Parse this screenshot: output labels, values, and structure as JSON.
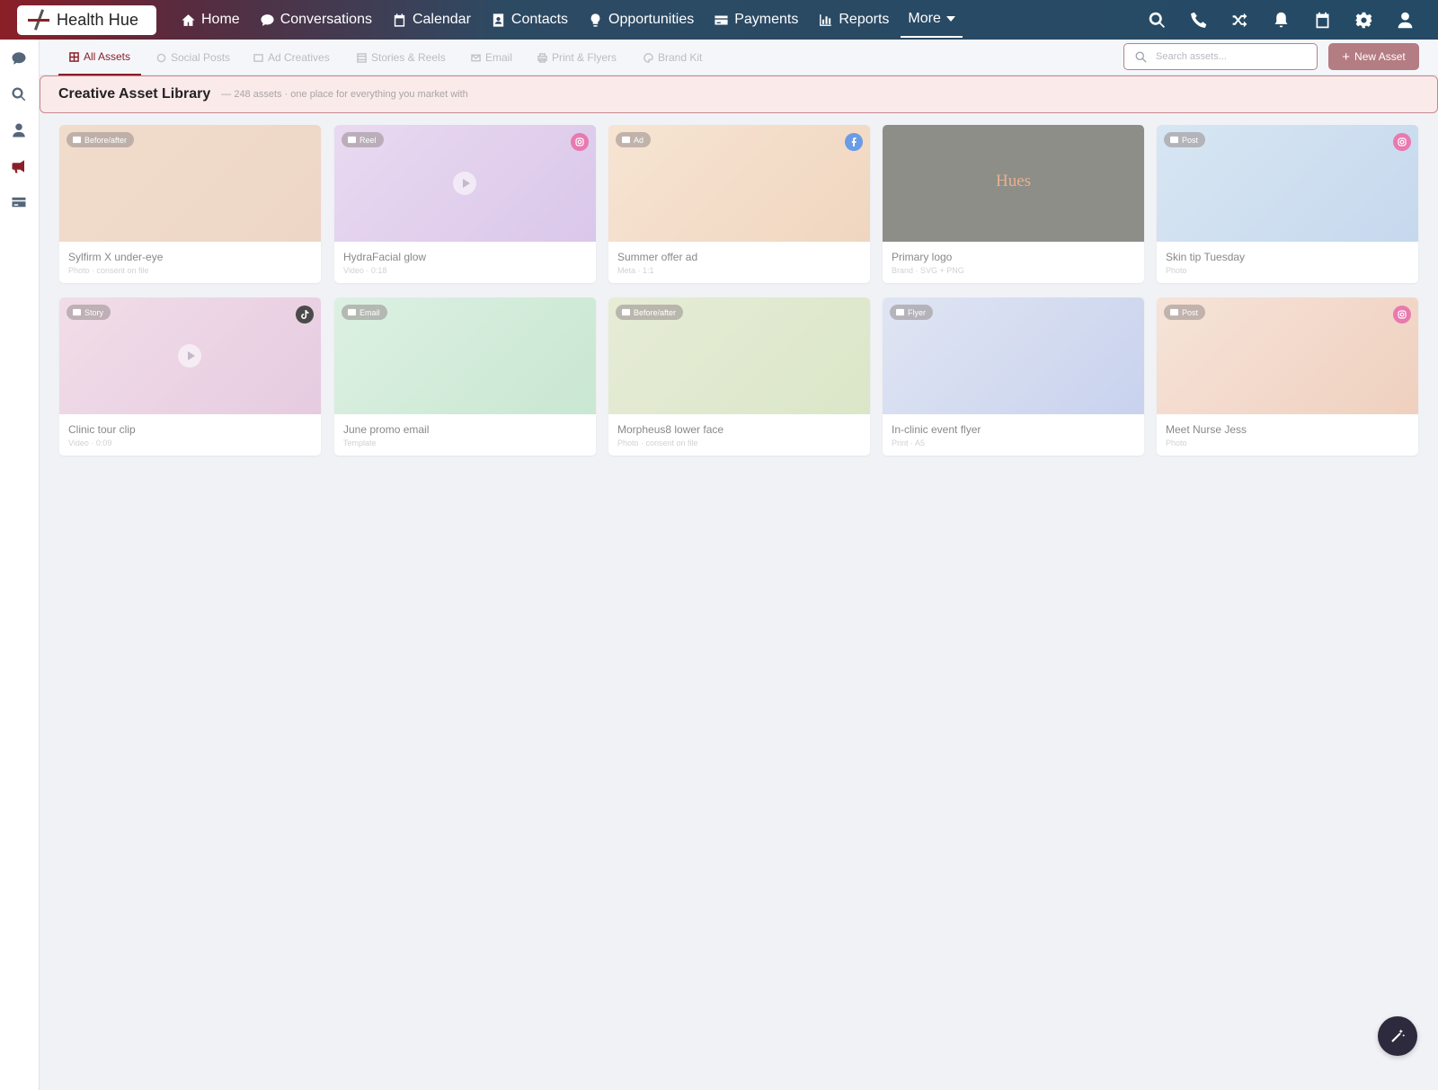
{
  "brand": {
    "name": "Health Hue"
  },
  "nav": {
    "items": [
      {
        "label": "Home",
        "icon": "home-icon"
      },
      {
        "label": "Conversations",
        "icon": "chat-icon"
      },
      {
        "label": "Calendar",
        "icon": "calendar-icon"
      },
      {
        "label": "Contacts",
        "icon": "contact-card-icon"
      },
      {
        "label": "Opportunities",
        "icon": "lightbulb-icon"
      },
      {
        "label": "Payments",
        "icon": "credit-card-icon"
      },
      {
        "label": "Reports",
        "icon": "bar-chart-icon"
      }
    ],
    "more_label": "More"
  },
  "top_icons": [
    "search-icon",
    "phone-icon",
    "shuffle-icon",
    "bell-icon",
    "calendar-icon",
    "gear-icon",
    "user-icon"
  ],
  "rail": [
    "chat-icon",
    "search-icon",
    "user-icon",
    "megaphone-icon",
    "credit-card-icon"
  ],
  "tabs": [
    {
      "label": "All Assets",
      "active": true
    },
    {
      "label": "Social Posts",
      "active": false
    },
    {
      "label": "Ad Creatives",
      "active": false
    },
    {
      "label": "Stories & Reels",
      "active": false
    },
    {
      "label": "Email",
      "active": false
    },
    {
      "label": "Print & Flyers",
      "active": false
    },
    {
      "label": "Brand Kit",
      "active": false
    }
  ],
  "search": {
    "placeholder": "Search assets..."
  },
  "new_asset": {
    "label": "New Asset"
  },
  "library": {
    "title": "Creative Asset Library",
    "subtitle": "— 248 assets · one place for everything you market with"
  },
  "assets": [
    {
      "badge": "Before/after",
      "title": "Sylfirm X under-eye",
      "meta": "Photo · consent on file",
      "platform": "",
      "gradient": [
        "#f1dccb",
        "#edd6c6"
      ]
    },
    {
      "badge": "Reel",
      "title": "HydraFacial glow",
      "meta": "Video · 0:18",
      "platform": "instagram",
      "gradient": [
        "#e9d9f0",
        "#dac7ea"
      ]
    },
    {
      "badge": "Ad",
      "title": "Summer offer ad",
      "meta": "Meta · 1:1",
      "platform": "facebook",
      "gradient": [
        "#f6e4d2",
        "#f0d6c0"
      ]
    },
    {
      "badge": "",
      "title": "Primary logo",
      "meta": "Brand · SVG + PNG",
      "platform": "",
      "logo": "Hues",
      "gradient": [
        "#8d8e88",
        "#8d8e88"
      ]
    },
    {
      "badge": "Post",
      "title": "Skin tip Tuesday",
      "meta": "Photo",
      "platform": "instagram",
      "gradient": [
        "#d7e6f2",
        "#c6d8ee"
      ]
    },
    {
      "badge": "Story",
      "title": "Clinic tour clip",
      "meta": "Video · 0:09",
      "platform": "tiktok",
      "gradient": [
        "#f1dde8",
        "#e6cbe0"
      ]
    },
    {
      "badge": "Email",
      "title": "June promo email",
      "meta": "Template",
      "platform": "",
      "gradient": [
        "#dcf0e2",
        "#c9e7d2"
      ]
    },
    {
      "badge": "Before/after",
      "title": "Morpheus8 lower face",
      "meta": "Photo · consent on file",
      "platform": "",
      "gradient": [
        "#e6ecd6",
        "#dbe6c8"
      ]
    },
    {
      "badge": "Flyer",
      "title": "In-clinic event flyer",
      "meta": "Print · A5",
      "platform": "",
      "gradient": [
        "#dfe5f3",
        "#c9d2ee"
      ]
    },
    {
      "badge": "Post",
      "title": "Meet Nurse Jess",
      "meta": "Photo",
      "platform": "instagram",
      "gradient": [
        "#f6e3d8",
        "#efd0bf"
      ]
    }
  ],
  "colors": {
    "accent": "#8b1f28",
    "instagram": "#e87ab0",
    "facebook": "#6a9be6",
    "tiktok": "#4a4a4a"
  }
}
